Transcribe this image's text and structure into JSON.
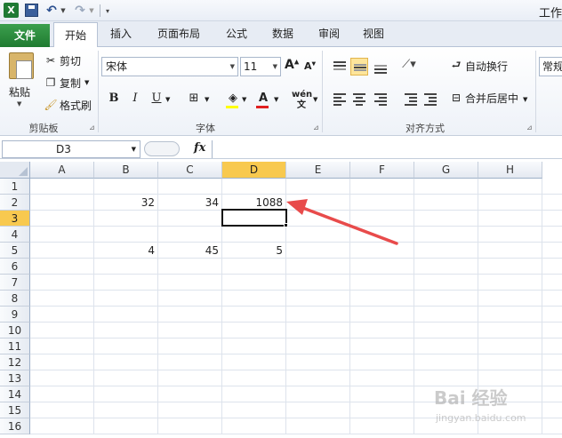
{
  "window": {
    "title": "工作"
  },
  "quick_access": {
    "app_icon": "excel-icon",
    "save": "save-icon",
    "undo": "undo-icon",
    "redo": "redo-icon"
  },
  "tabs": [
    "文件",
    "开始",
    "插入",
    "页面布局",
    "公式",
    "数据",
    "审阅",
    "视图"
  ],
  "ribbon": {
    "clipboard": {
      "paste": "粘贴",
      "cut": "剪切",
      "copy": "复制",
      "format_painter": "格式刷",
      "label": "剪贴板"
    },
    "font": {
      "name": "宋体",
      "size": "11",
      "label": "字体",
      "bold": "B",
      "italic": "I",
      "underline": "U",
      "wen": "wén 文",
      "fill_color": "#ffff00",
      "font_color": "#e02020"
    },
    "alignment": {
      "wrap": "自动换行",
      "merge": "合并后居中",
      "label": "对齐方式"
    },
    "number": {
      "format": "常规"
    }
  },
  "formula_bar": {
    "name_box": "D3",
    "fx": "fx",
    "content": ""
  },
  "grid": {
    "columns": [
      "A",
      "B",
      "C",
      "D",
      "E",
      "F",
      "G",
      "H"
    ],
    "rows": [
      "1",
      "2",
      "3",
      "4",
      "5",
      "6",
      "7",
      "8",
      "9",
      "10",
      "11",
      "12",
      "13",
      "14",
      "15",
      "16"
    ],
    "selected_cell": "D3",
    "cells": {
      "B2": "32",
      "C2": "34",
      "D2": "1088",
      "B5": "4",
      "C5": "45",
      "D5": "5"
    }
  },
  "annotation": {
    "arrow_color": "#e84b4b"
  },
  "watermark": {
    "text": "Bai 经验",
    "sub": "jingyan.baidu.com"
  }
}
